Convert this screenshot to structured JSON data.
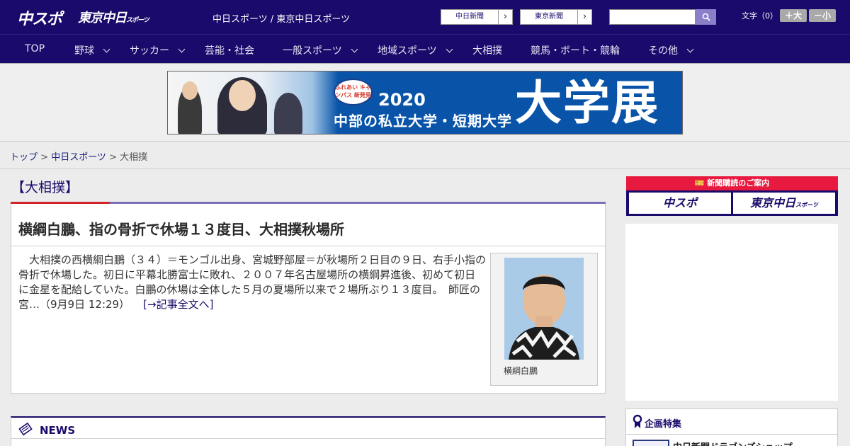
{
  "header": {
    "logo_chuspo": "中スポ",
    "logo_tokyo": "東京中日",
    "logo_tokyo_small": "スポーツ",
    "site_links": "中日スポーツ / 東京中日スポーツ",
    "paper_buttons": [
      "中日新聞",
      "東京新聞"
    ],
    "search_placeholder": "",
    "font_size_label": "文字（0）",
    "font_larger": "＋大",
    "font_smaller": "－小"
  },
  "nav": {
    "items": [
      "TOP",
      "野球",
      "サッカー",
      "芸能・社会",
      "一般スポーツ",
      "地域スポーツ",
      "大相撲",
      "競馬・ボート・競輪",
      "その他"
    ]
  },
  "banner": {
    "badge": "ふれあい キャンパス 新発見",
    "year": "2020",
    "subtitle": "中部の私立大学・短期大学",
    "big_text": "大学展"
  },
  "breadcrumb": {
    "top": "トップ",
    "section": "中日スポーツ",
    "current": "大相撲",
    "sep": " > "
  },
  "article": {
    "category": "【大相撲】",
    "headline": "横綱白鵬、指の骨折で休場１３度目、大相撲秋場所",
    "body": "　大相撲の西横綱白鵬（３４）＝モンゴル出身、宮城野部屋＝が秋場所２日目の９日、右手小指の骨折で休場した。初日に平幕北勝富士に敗れ、２００７年名古屋場所の横綱昇進後、初めて初日に金星を配給していた。白鵬の休場は全体した５月の夏場所以来で２場所ぶり１３度目。　師匠の宮…（9月9日 12:29）",
    "more_link": "[→記事全文へ]",
    "photo_caption": "横綱白鵬"
  },
  "news": {
    "title": "NEWS"
  },
  "sidebar": {
    "subscription_header": "新聞購読のご案内",
    "subscription_buttons": [
      "中スポ",
      "東京中日"
    ],
    "subscription_button_small": "スポーツ",
    "feature_title": "企画特集",
    "feature_item": "中日新聞ドラゴンズショップ"
  },
  "colors": {
    "header_bg": "#190a6b",
    "accent_red": "#e8193f",
    "link": "#1a237e"
  }
}
